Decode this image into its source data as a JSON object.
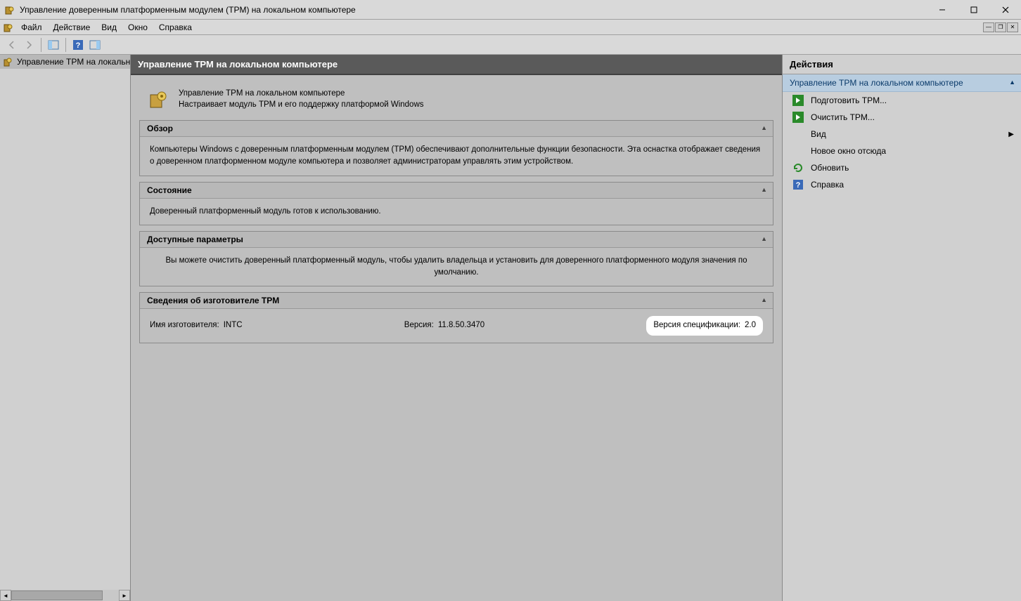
{
  "window": {
    "title": "Управление доверенным платформенным модулем (TPM) на локальном компьютере"
  },
  "menu": {
    "file": "Файл",
    "action": "Действие",
    "view": "Вид",
    "window": "Окно",
    "help": "Справка"
  },
  "tree": {
    "root": "Управление TPM на локальн"
  },
  "content": {
    "header": "Управление TPM на локальном компьютере",
    "intro_title": "Управление TPM на локальном компьютере",
    "intro_desc": "Настраивает модуль TPM и его поддержку платформой Windows",
    "sections": {
      "overview": {
        "title": "Обзор",
        "body": "Компьютеры Windows с доверенным платформенным модулем (TPM) обеспечивают дополнительные функции безопасности. Эта оснастка отображает сведения о доверенном платформенном модуле компьютера и позволяет администраторам управлять этим устройством."
      },
      "status": {
        "title": "Состояние",
        "body": "Доверенный платформенный модуль готов к использованию."
      },
      "options": {
        "title": "Доступные параметры",
        "body": "Вы можете очистить доверенный платформенный модуль, чтобы удалить владельца и установить для доверенного платформенного модуля значения по умолчанию."
      },
      "manufacturer": {
        "title": "Сведения об изготовителе TPM",
        "name_label": "Имя изготовителя:",
        "name_value": "INTC",
        "version_label": "Версия:",
        "version_value": "11.8.50.3470",
        "spec_label": "Версия спецификации:",
        "spec_value": "2.0"
      }
    }
  },
  "actions": {
    "header": "Действия",
    "subheader": "Управление TPM на локальном компьютере",
    "items": {
      "prepare": "Подготовить TPM...",
      "clear": "Очистить TPM...",
      "view": "Вид",
      "new_window": "Новое окно отсюда",
      "refresh": "Обновить",
      "help": "Справка"
    }
  }
}
